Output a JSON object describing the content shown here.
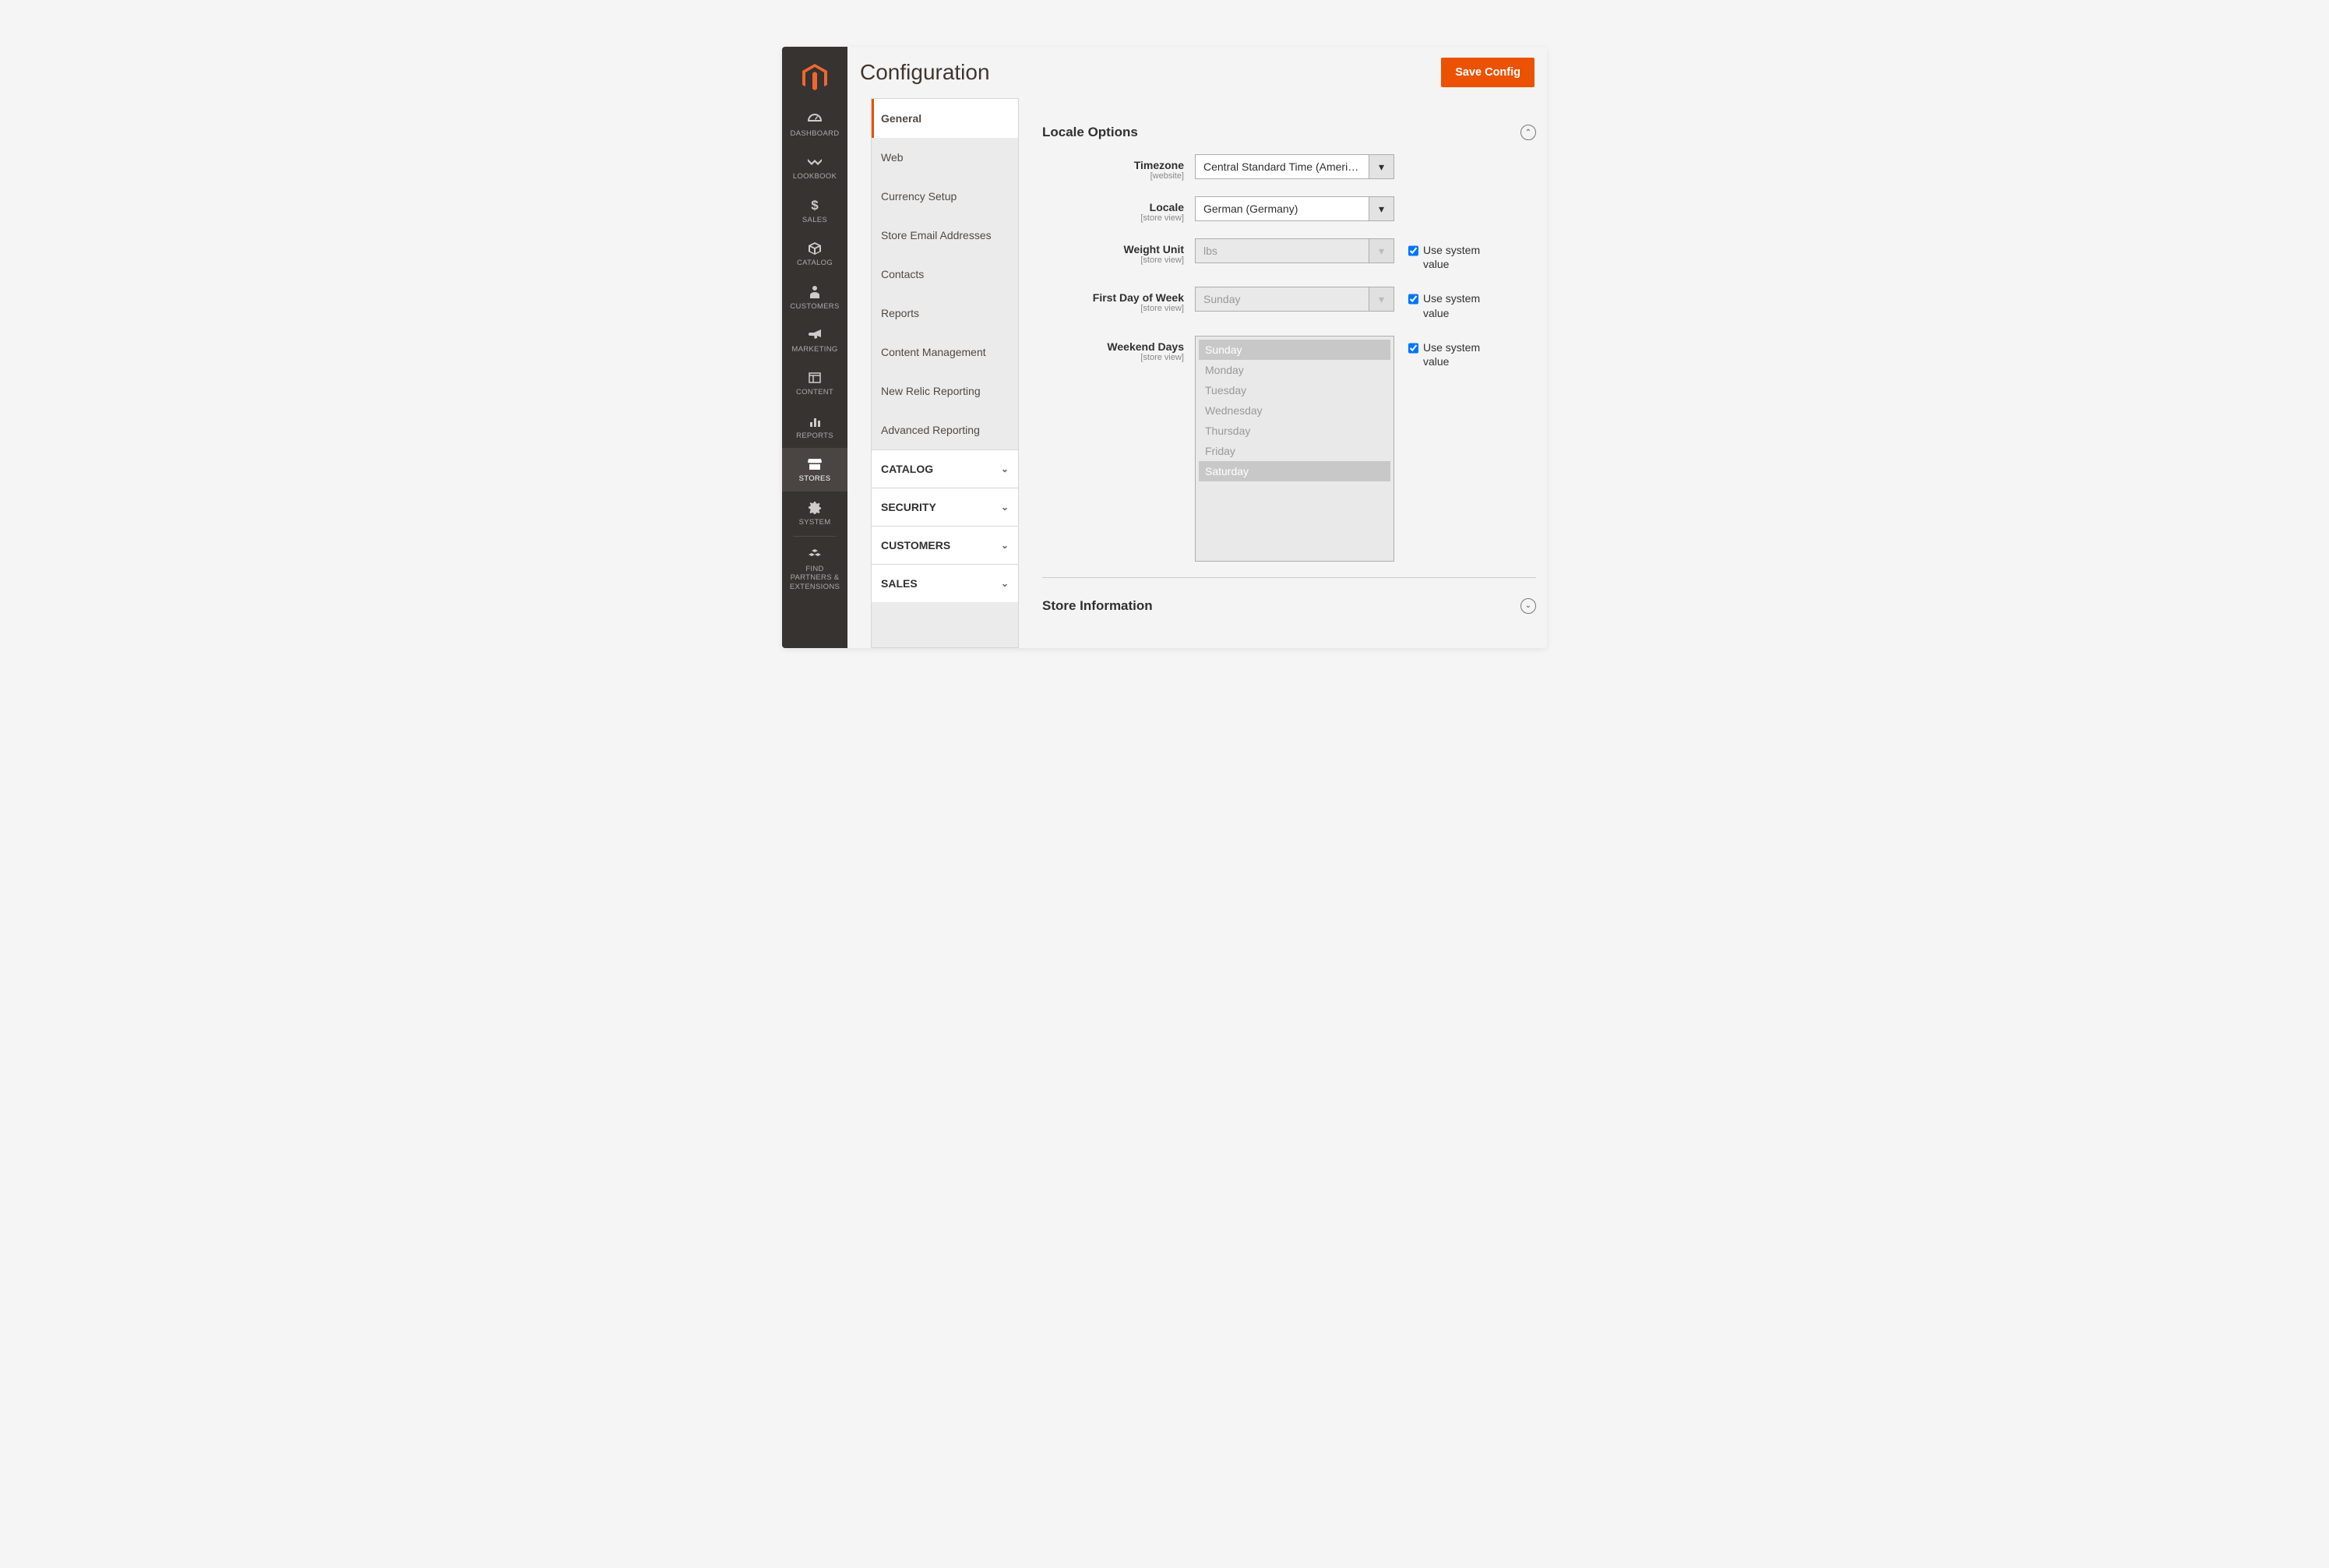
{
  "header": {
    "title": "Configuration",
    "save_button": "Save Config"
  },
  "sidebar": {
    "items": [
      {
        "label": "DASHBOARD"
      },
      {
        "label": "LOOKBOOK"
      },
      {
        "label": "SALES"
      },
      {
        "label": "CATALOG"
      },
      {
        "label": "CUSTOMERS"
      },
      {
        "label": "MARKETING"
      },
      {
        "label": "CONTENT"
      },
      {
        "label": "REPORTS"
      },
      {
        "label": "STORES",
        "active": true
      },
      {
        "label": "SYSTEM"
      },
      {
        "label": "FIND PARTNERS & EXTENSIONS"
      }
    ]
  },
  "config_sidebar": {
    "items": [
      {
        "label": "General",
        "active": true
      },
      {
        "label": "Web"
      },
      {
        "label": "Currency Setup"
      },
      {
        "label": "Store Email Addresses"
      },
      {
        "label": "Contacts"
      },
      {
        "label": "Reports"
      },
      {
        "label": "Content Management"
      },
      {
        "label": "New Relic Reporting"
      },
      {
        "label": "Advanced Reporting"
      }
    ],
    "groups": [
      {
        "label": "CATALOG"
      },
      {
        "label": "SECURITY"
      },
      {
        "label": "CUSTOMERS"
      },
      {
        "label": "SALES"
      }
    ]
  },
  "sections": {
    "locale": {
      "title": "Locale Options",
      "fields": {
        "timezone": {
          "label": "Timezone",
          "scope": "[website]",
          "value": "Central Standard Time (America/"
        },
        "locale": {
          "label": "Locale",
          "scope": "[store view]",
          "value": "German (Germany)"
        },
        "weight_unit": {
          "label": "Weight Unit",
          "scope": "[store view]",
          "value": "lbs",
          "use_system": true
        },
        "first_day": {
          "label": "First Day of Week",
          "scope": "[store view]",
          "value": "Sunday",
          "use_system": true
        },
        "weekend": {
          "label": "Weekend Days",
          "scope": "[store view]",
          "options": [
            "Sunday",
            "Monday",
            "Tuesday",
            "Wednesday",
            "Thursday",
            "Friday",
            "Saturday"
          ],
          "selected": [
            "Sunday",
            "Saturday"
          ],
          "use_system": true
        }
      },
      "use_system_label": "Use system value"
    },
    "store_info": {
      "title": "Store Information"
    }
  }
}
